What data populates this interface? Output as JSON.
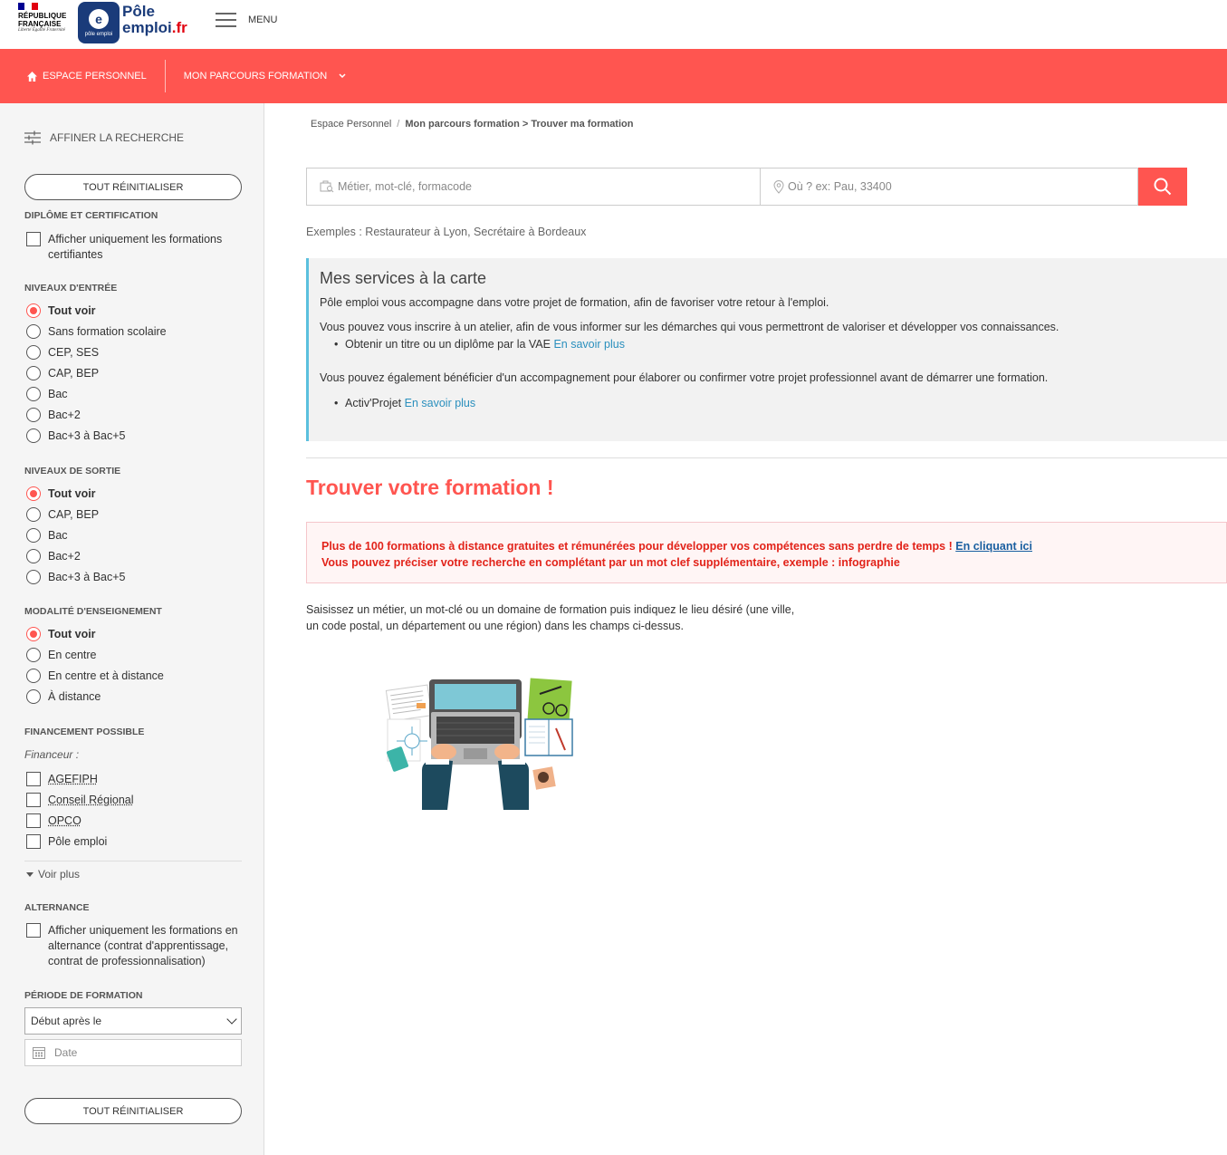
{
  "header": {
    "rf_text": "RÉPUBLIQUE FRANÇAISE",
    "rf_motto": "Liberté Égalité Fraternité",
    "pe_small": "pôle emploi",
    "pe_name_1": "Pôle",
    "pe_name_2": "emploi",
    "pe_name_3": ".fr",
    "menu_label": "MENU"
  },
  "nav": {
    "espace": "ESPACE PERSONNEL",
    "parcours": "MON PARCOURS FORMATION"
  },
  "sidebar": {
    "affiner": "AFFINER LA RECHERCHE",
    "reset": "TOUT RÉINITIALISER",
    "diplome_title": "DIPLÔME ET CERTIFICATION",
    "diplome_opt": "Afficher uniquement les formations certifiantes",
    "entree_title": "NIVEAUX D'ENTRÉE",
    "entree": [
      "Tout voir",
      "Sans formation scolaire",
      "CEP, SES",
      "CAP, BEP",
      "Bac",
      "Bac+2",
      "Bac+3 à Bac+5"
    ],
    "sortie_title": "NIVEAUX DE SORTIE",
    "sortie": [
      "Tout voir",
      "CAP, BEP",
      "Bac",
      "Bac+2",
      "Bac+3 à Bac+5"
    ],
    "modalite_title": "MODALITÉ D'ENSEIGNEMENT",
    "modalite": [
      "Tout voir",
      "En centre",
      "En centre et à distance",
      "À distance"
    ],
    "financement_title": "FINANCEMENT POSSIBLE",
    "financeur": "Financeur :",
    "financement": [
      "AGEFIPH",
      "Conseil Régional",
      "OPCO",
      "Pôle emploi"
    ],
    "voir_plus": "Voir plus",
    "alternance_title": "ALTERNANCE",
    "alternance_opt": "Afficher uniquement les formations en alternance (contrat d'apprentissage, contrat de professionnalisation)",
    "periode_title": "PÉRIODE DE FORMATION",
    "periode_select": "Début après le",
    "date_placeholder": "Date"
  },
  "breadcrumb": {
    "home": "Espace Personnel",
    "sep": "/",
    "current": "Mon parcours formation > Trouver ma formation"
  },
  "search": {
    "metier_placeholder": "Métier, mot-clé, formacode",
    "lieu_placeholder": "Où ? ex: Pau, 33400",
    "exemples": "Exemples : Restaurateur à Lyon, Secrétaire à Bordeaux"
  },
  "services": {
    "title": "Mes services à la carte",
    "p1": "Pôle emploi vous accompagne dans votre projet de formation, afin de favoriser votre retour à l'emploi.",
    "p2": "Vous pouvez vous inscrire à un atelier, afin de vous informer sur les démarches qui vous permettront de valoriser et développer vos connaissances.",
    "li1": "Obtenir un titre ou un diplôme par la VAE",
    "link": "En savoir plus",
    "p3": "Vous pouvez également bénéficier d'un accompagnement pour élaborer ou confirmer votre projet professionnel avant de démarrer une formation.",
    "li2": "Activ'Projet"
  },
  "main": {
    "trouver": "Trouver votre formation !",
    "alert_1": "Plus de 100 formations à distance gratuites et rémunérées pour développer vos compétences sans perdre de temps !",
    "alert_link": "En cliquant ici",
    "alert_2": "Vous pouvez préciser votre recherche en complétant par un mot clef supplémentaire, exemple : infographie",
    "desc": "Saisissez un métier, un mot-clé ou un domaine de formation puis indiquez le lieu désiré (une ville, un code postal, un département ou une région) dans les champs ci-dessus."
  },
  "colors": {
    "accent": "#ff5550",
    "brand": "#1a3b7a",
    "link": "#2a8fbd"
  }
}
